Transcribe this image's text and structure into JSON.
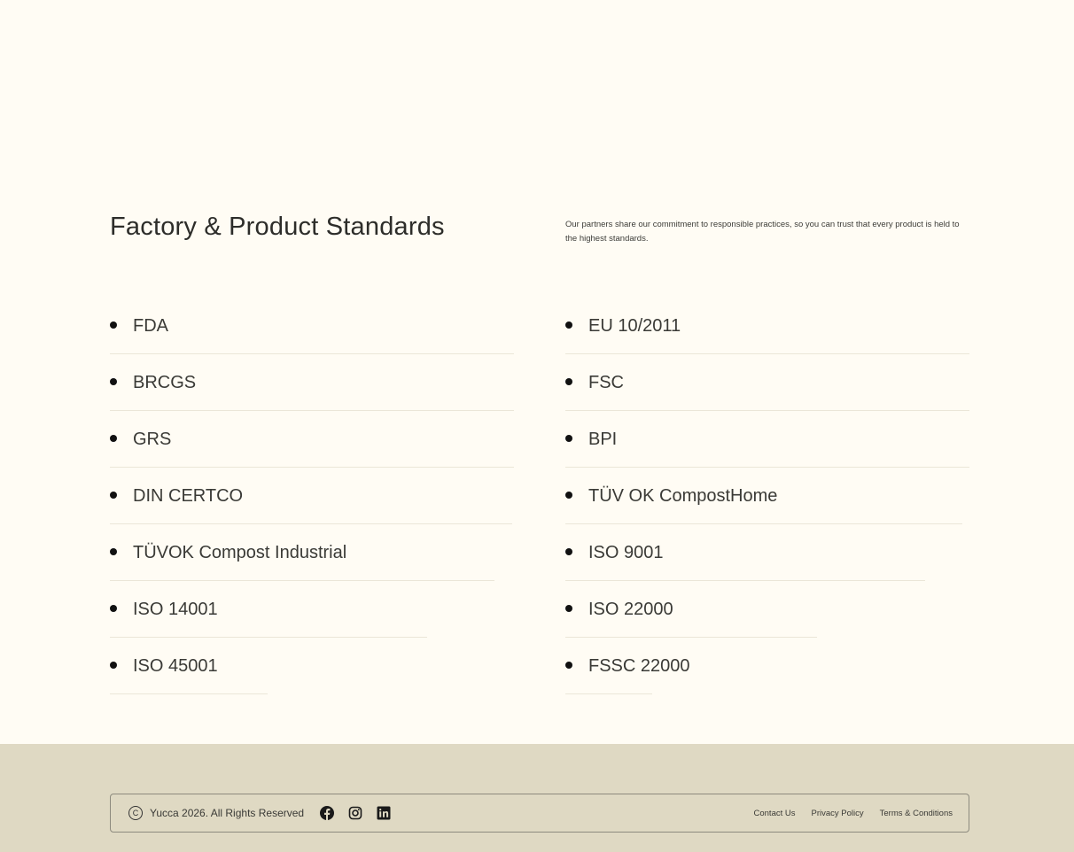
{
  "standards": {
    "title": "Factory & Product Standards",
    "intro": "Our partners share our commitment to responsible practices, so you can trust that every product is held to the highest standards.",
    "left_items": [
      {
        "label": "FDA"
      },
      {
        "label": "BRCGS"
      },
      {
        "label": "GRS"
      },
      {
        "label": "DIN CERTCO"
      },
      {
        "label": "TÜVOK Compost Industrial"
      },
      {
        "label": "ISO 14001"
      },
      {
        "label": "ISO 45001"
      }
    ],
    "right_items": [
      {
        "label": "EU 10/2011"
      },
      {
        "label": "FSC"
      },
      {
        "label": "BPI"
      },
      {
        "label": "TÜV OK CompostHome"
      },
      {
        "label": "ISO 9001"
      },
      {
        "label": "ISO 22000"
      },
      {
        "label": "FSSC 22000"
      }
    ]
  },
  "footer": {
    "copyright_symbol": "C",
    "copyright": "Yucca 2026. All Rights Reserved",
    "social": [
      {
        "icon": "facebook-icon"
      },
      {
        "icon": "instagram-icon"
      },
      {
        "icon": "linkedin-icon"
      }
    ],
    "links": [
      {
        "label": "Contact Us"
      },
      {
        "label": "Privacy Policy"
      },
      {
        "label": "Terms & Conditions"
      }
    ]
  },
  "colors": {
    "page_bg": "#fffcf4",
    "footer_bg": "#dfd9c3",
    "rule": "#ebe6d8",
    "bullet": "#111111"
  }
}
